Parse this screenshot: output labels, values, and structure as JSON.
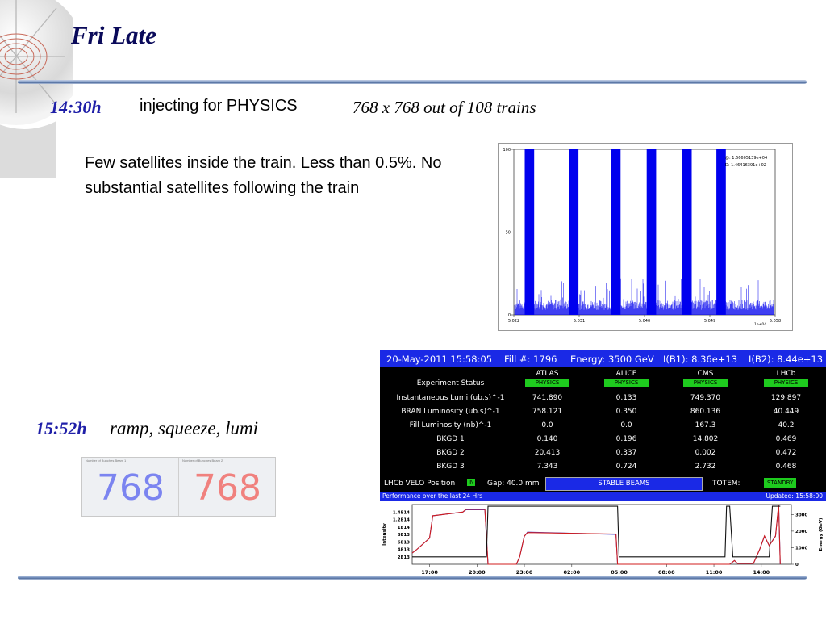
{
  "slide": {
    "title": "Fri Late",
    "items": [
      {
        "time": "14:30h",
        "text": "injecting for PHYSICS",
        "note": "768 x 768 out of 108 trains"
      },
      {
        "time": "15:52h",
        "text": "ramp, squeeze, lumi"
      }
    ],
    "paragraph": "Few satellites inside the train. Less than 0.5%. No substantial satellites following the train"
  },
  "counters": {
    "left_caption": "Number of Bunches Beam 1",
    "right_caption": "Number of Bunches Beam 2",
    "left_value": "768",
    "right_value": "768"
  },
  "lhc_page": {
    "header": {
      "datetime": "20-May-2011 15:58:05",
      "fill": "Fill #: 1796",
      "energy": "Energy: 3500 GeV",
      "ib1": "I(B1): 8.36e+13",
      "ib2": "I(B2): 8.44e+13"
    },
    "experiments": [
      "ATLAS",
      "ALICE",
      "CMS",
      "LHCb"
    ],
    "rows": [
      {
        "label": "Experiment Status",
        "values": [
          "PHYSICS",
          "PHYSICS",
          "PHYSICS",
          "PHYSICS"
        ]
      },
      {
        "label": "Instantaneous Lumi (ub.s)^-1",
        "values": [
          "741.890",
          "0.133",
          "749.370",
          "129.897"
        ]
      },
      {
        "label": "BRAN Luminosity (ub.s)^-1",
        "values": [
          "758.121",
          "0.350",
          "860.136",
          "40.449"
        ]
      },
      {
        "label": "Fill Luminosity (nb)^-1",
        "values": [
          "0.0",
          "0.0",
          "167.3",
          "40.2"
        ]
      },
      {
        "label": "BKGD 1",
        "values": [
          "0.140",
          "0.196",
          "14.802",
          "0.469"
        ]
      },
      {
        "label": "BKGD 2",
        "values": [
          "20.413",
          "0.337",
          "0.002",
          "0.472"
        ]
      },
      {
        "label": "BKGD 3",
        "values": [
          "7.343",
          "0.724",
          "2.732",
          "0.468"
        ]
      }
    ],
    "velo": {
      "label": "LHCb VELO Position",
      "in": "IN",
      "gap": "Gap: 40.0 mm",
      "mode": "STABLE BEAMS",
      "totem": "TOTEM:",
      "totem_status": "STANDBY"
    },
    "perf": {
      "title": "Performance over the last 24 Hrs",
      "updated": "Updated: 15:58:00"
    }
  },
  "chart_data": [
    {
      "type": "line",
      "title": "",
      "annotations": [
        "@: 1.66605139e+04",
        "D: 1.46416391e+02"
      ],
      "x_tick_labels": [
        "5.022",
        "5.031",
        "5.040",
        "5.049",
        "5.058"
      ],
      "x_multiplier": "1e+04",
      "x_unit_range": [
        5.022,
        5.058
      ],
      "ylim": [
        0,
        100
      ],
      "y_ticks": [
        0,
        50,
        100
      ],
      "series": [
        {
          "color": "#0000ee",
          "baseline": 3,
          "trains": [
            {
              "start": 5.0235,
              "end": 5.0248,
              "peak": 100
            },
            {
              "start": 5.0296,
              "end": 5.0309,
              "peak": 100
            },
            {
              "start": 5.0354,
              "end": 5.0367,
              "peak": 100
            },
            {
              "start": 5.0403,
              "end": 5.0416,
              "peak": 100
            },
            {
              "start": 5.0452,
              "end": 5.0465,
              "peak": 100
            },
            {
              "start": 5.0499,
              "end": 5.0512,
              "peak": 100
            }
          ],
          "satellite_level": 12
        }
      ]
    },
    {
      "type": "line",
      "title": "Performance over the last 24 Hrs",
      "x_tick_labels": [
        "17:00",
        "20:00",
        "23:00",
        "02:00",
        "05:00",
        "08:00",
        "11:00",
        "14:00"
      ],
      "ylabel_left": "Intensity",
      "ylabel_right": "Energy (GeV)",
      "y_left_ticks": [
        "2E13",
        "4E13",
        "6E13",
        "8E13",
        "1E14",
        "1.2E14",
        "1.4E14"
      ],
      "y_left_range": [
        0,
        160000000000000.0
      ],
      "y_right_ticks": [
        0,
        1000,
        2000,
        3000
      ],
      "y_right_range": [
        0,
        3600
      ],
      "series": [
        {
          "name": "",
          "axis": "left",
          "color": "#3d3dcf",
          "points": [
            [
              0,
              30000000000000.0
            ],
            [
              0.3,
              40000000000000.0
            ],
            [
              1.1,
              70000000000000.0
            ],
            [
              1.3,
              130000000000000.0
            ],
            [
              3.2,
              140000000000000.0
            ],
            [
              3.4,
              146000000000000.0
            ],
            [
              4.6,
              146000000000000.0
            ],
            [
              4.8,
              0
            ],
            [
              6.6,
              0
            ],
            [
              6.8,
              20000000000000.0
            ],
            [
              7.1,
              75000000000000.0
            ],
            [
              7.3,
              86000000000000.0
            ],
            [
              12.9,
              80000000000000.0
            ],
            [
              13.0,
              0
            ],
            [
              20.1,
              0
            ],
            [
              20.4,
              10000000000000.0
            ],
            [
              20.6,
              2000000000000.0
            ],
            [
              21.6,
              2000000000000.0
            ],
            [
              22.0,
              40000000000000.0
            ],
            [
              22.3,
              75000000000000.0
            ],
            [
              22.6,
              50000000000000.0
            ],
            [
              23.0,
              76000000000000.0
            ],
            [
              23.2,
              158000000000000.0
            ],
            [
              23.3,
              0
            ]
          ]
        },
        {
          "name": "",
          "axis": "left",
          "color": "#d11d1d",
          "points": [
            [
              0,
              30000000000000.0
            ],
            [
              0.3,
              40000000000000.0
            ],
            [
              1.1,
              70000000000000.0
            ],
            [
              1.3,
              130000000000000.0
            ],
            [
              3.2,
              140000000000000.0
            ],
            [
              3.4,
              147000000000000.0
            ],
            [
              4.6,
              147000000000000.0
            ],
            [
              4.8,
              0
            ],
            [
              6.6,
              0
            ],
            [
              6.8,
              20000000000000.0
            ],
            [
              7.1,
              75000000000000.0
            ],
            [
              7.3,
              85000000000000.0
            ],
            [
              12.9,
              81000000000000.0
            ],
            [
              13.0,
              0
            ],
            [
              20.1,
              0
            ],
            [
              20.4,
              10000000000000.0
            ],
            [
              20.6,
              2000000000000.0
            ],
            [
              21.6,
              2000000000000.0
            ],
            [
              22.0,
              40000000000000.0
            ],
            [
              22.3,
              76000000000000.0
            ],
            [
              22.6,
              50000000000000.0
            ],
            [
              23.0,
              75000000000000.0
            ],
            [
              23.2,
              160000000000000.0
            ],
            [
              23.3,
              0
            ]
          ]
        },
        {
          "name": "",
          "axis": "right",
          "color": "#111111",
          "points": [
            [
              0,
              450
            ],
            [
              4.7,
              450
            ],
            [
              4.8,
              3500
            ],
            [
              13.0,
              3500
            ],
            [
              13.1,
              450
            ],
            [
              19.8,
              450
            ],
            [
              19.9,
              3500
            ],
            [
              20.1,
              3500
            ],
            [
              20.3,
              450
            ],
            [
              22.6,
              450
            ],
            [
              22.8,
              3500
            ],
            [
              23.3,
              3500
            ]
          ]
        }
      ]
    }
  ]
}
